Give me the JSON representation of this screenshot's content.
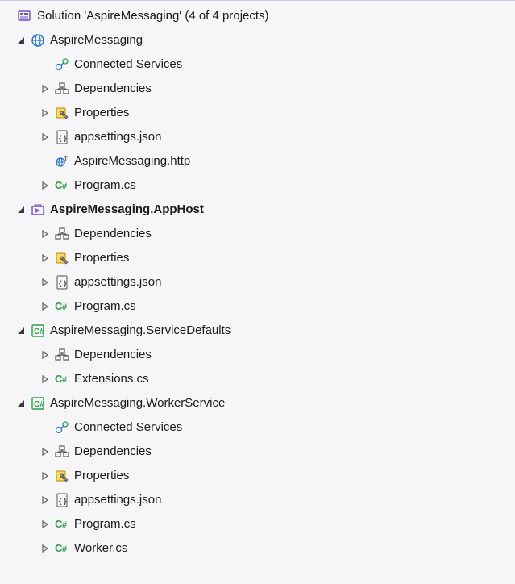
{
  "solution": {
    "label": "Solution 'AspireMessaging' (4 of 4 projects)"
  },
  "projects": [
    {
      "name": "AspireMessaging",
      "bold": false,
      "icon": "web-project",
      "expanded": true,
      "children": [
        {
          "name": "Connected Services",
          "icon": "connected-services",
          "expandable": true,
          "expanded": false,
          "show_expander": false
        },
        {
          "name": "Dependencies",
          "icon": "dependencies",
          "expandable": true,
          "expanded": false,
          "show_expander": true
        },
        {
          "name": "Properties",
          "icon": "properties",
          "expandable": true,
          "expanded": false,
          "show_expander": true
        },
        {
          "name": "appsettings.json",
          "icon": "json-file",
          "expandable": true,
          "expanded": false,
          "show_expander": true
        },
        {
          "name": "AspireMessaging.http",
          "icon": "http-file",
          "expandable": false
        },
        {
          "name": "Program.cs",
          "icon": "cs-file",
          "expandable": true,
          "expanded": false,
          "show_expander": true
        }
      ]
    },
    {
      "name": "AspireMessaging.AppHost",
      "bold": true,
      "icon": "apphost-project",
      "expanded": true,
      "children": [
        {
          "name": "Dependencies",
          "icon": "dependencies",
          "expandable": true,
          "expanded": false,
          "show_expander": true
        },
        {
          "name": "Properties",
          "icon": "properties",
          "expandable": true,
          "expanded": false,
          "show_expander": true
        },
        {
          "name": "appsettings.json",
          "icon": "json-file",
          "expandable": true,
          "expanded": false,
          "show_expander": true
        },
        {
          "name": "Program.cs",
          "icon": "cs-file",
          "expandable": true,
          "expanded": false,
          "show_expander": true
        }
      ]
    },
    {
      "name": "AspireMessaging.ServiceDefaults",
      "bold": false,
      "icon": "csharp-project",
      "expanded": true,
      "children": [
        {
          "name": "Dependencies",
          "icon": "dependencies",
          "expandable": true,
          "expanded": false,
          "show_expander": true
        },
        {
          "name": "Extensions.cs",
          "icon": "cs-file",
          "expandable": true,
          "expanded": false,
          "show_expander": true
        }
      ]
    },
    {
      "name": "AspireMessaging.WorkerService",
      "bold": false,
      "icon": "csharp-project",
      "expanded": true,
      "children": [
        {
          "name": "Connected Services",
          "icon": "connected-services",
          "expandable": true,
          "expanded": false,
          "show_expander": false
        },
        {
          "name": "Dependencies",
          "icon": "dependencies",
          "expandable": true,
          "expanded": false,
          "show_expander": true
        },
        {
          "name": "Properties",
          "icon": "properties",
          "expandable": true,
          "expanded": false,
          "show_expander": true
        },
        {
          "name": "appsettings.json",
          "icon": "json-file",
          "expandable": true,
          "expanded": false,
          "show_expander": true
        },
        {
          "name": "Program.cs",
          "icon": "cs-file",
          "expandable": true,
          "expanded": false,
          "show_expander": true
        },
        {
          "name": "Worker.cs",
          "icon": "cs-file",
          "expandable": true,
          "expanded": false,
          "show_expander": true
        }
      ]
    }
  ]
}
